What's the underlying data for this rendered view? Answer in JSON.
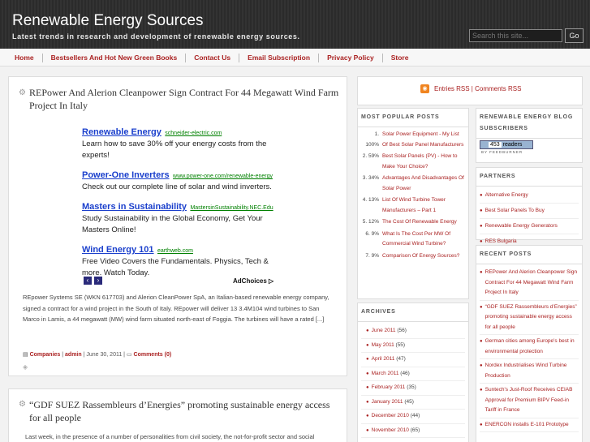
{
  "header": {
    "title": "Renewable Energy Sources",
    "description": "Latest trends in research and development of renewable energy sources.",
    "search_placeholder": "Search this site...",
    "search_button": "Go"
  },
  "nav": {
    "items": [
      "Home",
      "Bestsellers And Hot New Green Books",
      "Contact Us",
      "Email Subscription",
      "Privacy Policy",
      "Store"
    ]
  },
  "posts": [
    {
      "title": "REPower And Alerion Cleanpower Sign Contract For 44 Megawatt Wind Farm Project In Italy",
      "ads": [
        {
          "title": "Renewable Energy",
          "url": "schneider-electric.com",
          "desc": "Learn how to save 30% off your energy costs from the experts!"
        },
        {
          "title": "Power-One Inverters",
          "url": "www.power-one.com/renewable-energy",
          "desc": "Check out our complete line of solar and wind inverters."
        },
        {
          "title": "Masters in Sustainability",
          "url": "MastersinSustainability.NEC.Edu",
          "desc": "Study Sustainability in the Global Economy, Get Your Masters Online!"
        },
        {
          "title": "Wind Energy 101",
          "url": "earthweb.com",
          "desc": "Free Video Covers the Fundamentals. Physics, Tech & more. Watch Today."
        }
      ],
      "adchoices": "AdChoices",
      "excerpt": "REpower Systems SE (WKN 617703) and Alerion CleanPower SpA, an Italian-based renewable energy company, signed a contract for a wind project in the South of Italy. REpower will deliver 13 3.4M104 wind turbines to San Marco in Lamis, a 44 megawatt (MW) wind farm situated north-east of Foggia. The turbines will have a rated [...]",
      "meta": {
        "categories": "Companies",
        "author": "admin",
        "date": "June 30, 2011",
        "comments": "Comments (0)"
      }
    },
    {
      "title": "“GDF SUEZ Rassembleurs d’Energies” promoting sustainable energy access for all people",
      "excerpt": "Last week, in the presence of a number of personalities from civil society, the not-for-profit sector and social"
    }
  ],
  "sidebar": {
    "rss": "Entries RSS | Comments RSS",
    "popular": {
      "title": "Most Popular Posts",
      "items": [
        {
          "pct": "1. 100%",
          "text": "Solar Power Equipment - My List Of Best Solar Panel Manufacturers"
        },
        {
          "pct": "2. 59%",
          "text": "Best Solar Panels (PV) - How to Make Your Choice?"
        },
        {
          "pct": "3. 34%",
          "text": "Advantages And Disadvantages Of Solar Power"
        },
        {
          "pct": "4. 13%",
          "text": "List Of Wind Turbine Tower Manufacturers – Part 1"
        },
        {
          "pct": "5. 12%",
          "text": "The Cost Of Renewable Energy"
        },
        {
          "pct": "6. 9%",
          "text": "What Is The Cost Per MW Of Commercial Wind Turbine?"
        },
        {
          "pct": "7. 9%",
          "text": "Comparison Of Energy Sources?"
        }
      ]
    },
    "archives": {
      "title": "Archives",
      "items": [
        {
          "month": "June 2011",
          "count": "(56)"
        },
        {
          "month": "May 2011",
          "count": "(55)"
        },
        {
          "month": "April 2011",
          "count": "(47)"
        },
        {
          "month": "March 2011",
          "count": "(46)"
        },
        {
          "month": "February 2011",
          "count": "(35)"
        },
        {
          "month": "January 2011",
          "count": "(45)"
        },
        {
          "month": "December 2010",
          "count": "(44)"
        },
        {
          "month": "November 2010",
          "count": "(65)"
        }
      ]
    },
    "subscribers": {
      "title": "Renewable Energy Blog Subscribers",
      "count": "453",
      "count_label": "readers",
      "by": "BY FEEDBURNER"
    },
    "partners": {
      "title": "Partners",
      "items": [
        "Alternative Energy",
        "Best Solar Panels To Buy",
        "Renewable Energy Generators",
        "RES Bulgaria"
      ]
    },
    "recent": {
      "title": "Recent Posts",
      "items": [
        "REPower And Alerion Cleanpower Sign Contract For 44 Megawatt Wind Farm Project In Italy",
        "“GDF SUEZ Rassembleurs d’Energies” promoting sustainable energy access for all people",
        "German cities among Europe's best in environmental protection",
        "Nordex Industrialises Wind Turbine Production",
        "Suntech's Just-Roof Receives CEIAB Approval for Premium BIPV Feed-in Tariff in France",
        "ENERCON installs E-101 Prototype"
      ]
    },
    "colors": {
      "link": "#aa2222",
      "header_bg": "#2b2b2b"
    }
  }
}
